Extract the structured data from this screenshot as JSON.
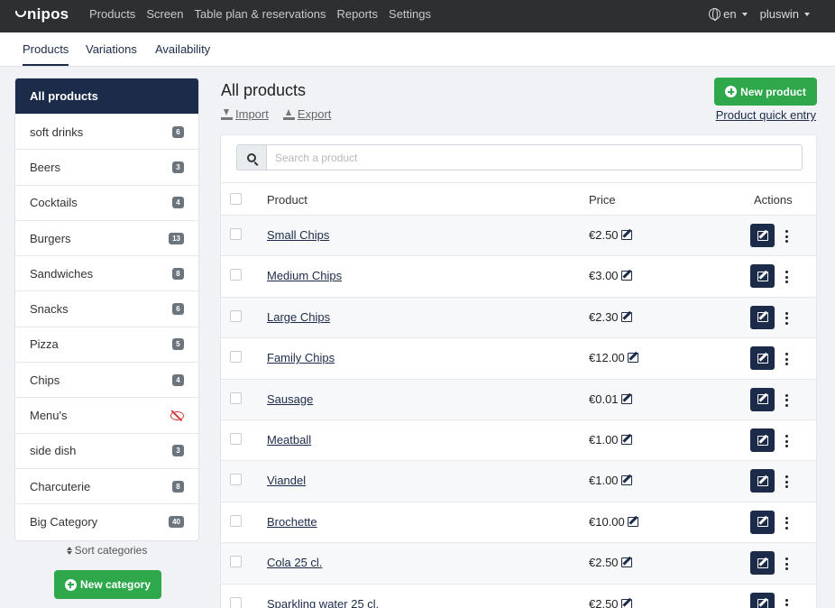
{
  "app": {
    "brand": "unipos",
    "nav": [
      "Products",
      "Screen",
      "Table plan & reservations",
      "Reports",
      "Settings"
    ],
    "language": "en",
    "user": "pluswin"
  },
  "subtabs": [
    "Products",
    "Variations",
    "Availability"
  ],
  "sidebar": {
    "categories": [
      {
        "label": "All products",
        "count": "",
        "active": true
      },
      {
        "label": "soft drinks",
        "count": "6"
      },
      {
        "label": "Beers",
        "count": "3"
      },
      {
        "label": "Cocktails",
        "count": "4"
      },
      {
        "label": "Burgers",
        "count": "13"
      },
      {
        "label": "Sandwiches",
        "count": "8"
      },
      {
        "label": "Snacks",
        "count": "6"
      },
      {
        "label": "Pizza",
        "count": "5"
      },
      {
        "label": "Chips",
        "count": "4"
      },
      {
        "label": "Menu's",
        "count": "",
        "hidden": true
      },
      {
        "label": "side dish",
        "count": "3"
      },
      {
        "label": "Charcuterie",
        "count": "8"
      },
      {
        "label": "Big Category",
        "count": "40"
      }
    ],
    "sort_label": "Sort categories",
    "new_category_label": "New category"
  },
  "main": {
    "title": "All products",
    "import_label": "Import",
    "export_label": "Export",
    "new_product_label": "New product",
    "quick_entry_label": "Product quick entry",
    "search_placeholder": "Search a product",
    "columns": {
      "product": "Product",
      "price": "Price",
      "actions": "Actions"
    },
    "products": [
      {
        "name": "Small Chips",
        "price": "€2.50"
      },
      {
        "name": "Medium Chips",
        "price": "€3.00"
      },
      {
        "name": "Large Chips",
        "price": "€2.30"
      },
      {
        "name": "Family Chips",
        "price": "€12.00"
      },
      {
        "name": "Sausage",
        "price": "€0.01"
      },
      {
        "name": "Meatball",
        "price": "€1.00"
      },
      {
        "name": "Viandel",
        "price": "€1.00"
      },
      {
        "name": "Brochette",
        "price": "€10.00"
      },
      {
        "name": "Cola 25 cl.",
        "price": "€2.50"
      },
      {
        "name": "Sparkling water 25 cl.",
        "price": "€2.50"
      }
    ]
  },
  "colors": {
    "navbar": "#2d2f31",
    "primary": "#1c2b4a",
    "success": "#2ea84a",
    "badge": "#6c757d",
    "hidden_icon": "#d03a3a"
  }
}
